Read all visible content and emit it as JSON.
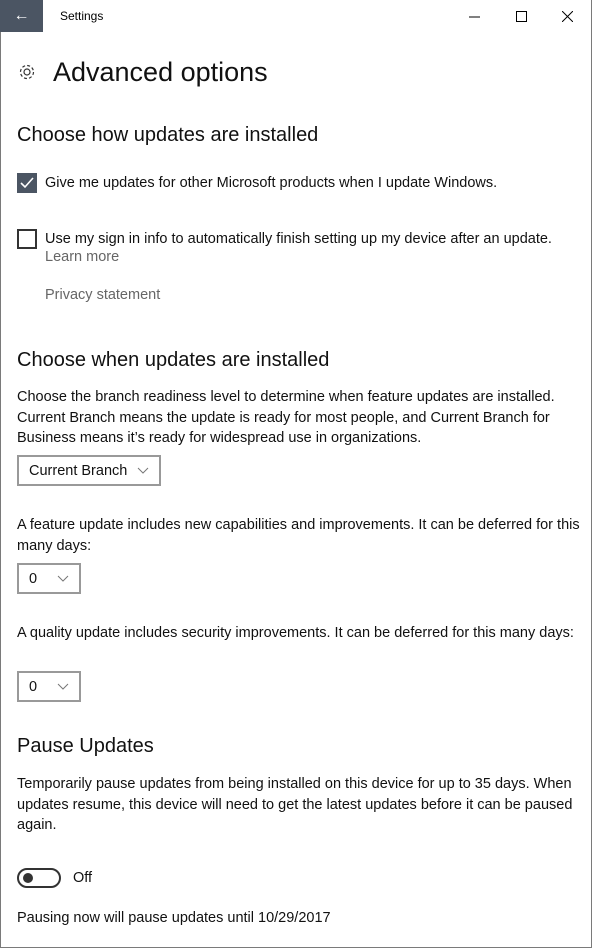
{
  "window": {
    "title": "Settings"
  },
  "page": {
    "title": "Advanced options"
  },
  "install": {
    "heading": "Choose how updates are installed",
    "option1": {
      "label": "Give me updates for other Microsoft products when I update Windows.",
      "checked": true
    },
    "option2": {
      "label": "Use my sign in info to automatically finish setting up my device after an update.",
      "checked": false
    },
    "learn_more": "Learn more",
    "privacy": "Privacy statement"
  },
  "when": {
    "heading": "Choose when updates are installed",
    "branch_desc": "Choose the branch readiness level to determine when feature updates are installed. Current Branch means the update is ready for most people, and Current Branch for Business means it’s ready for widespread use in organizations.",
    "branch_value": "Current Branch",
    "feature_desc": "A feature update includes new capabilities and improvements. It can be deferred for this many days:",
    "feature_value": "0",
    "quality_desc": "A quality update includes security improvements. It can be deferred for this many days:",
    "quality_value": "0"
  },
  "pause": {
    "heading": "Pause Updates",
    "desc": "Temporarily pause updates from being installed on this device for up to 35 days. When updates resume, this device will need to get the latest updates before it can be paused again.",
    "toggle_label": "Off",
    "toggle_on": false,
    "note": "Pausing now will pause updates until 10/29/2017"
  },
  "colors": {
    "accent": "#4b5563"
  }
}
